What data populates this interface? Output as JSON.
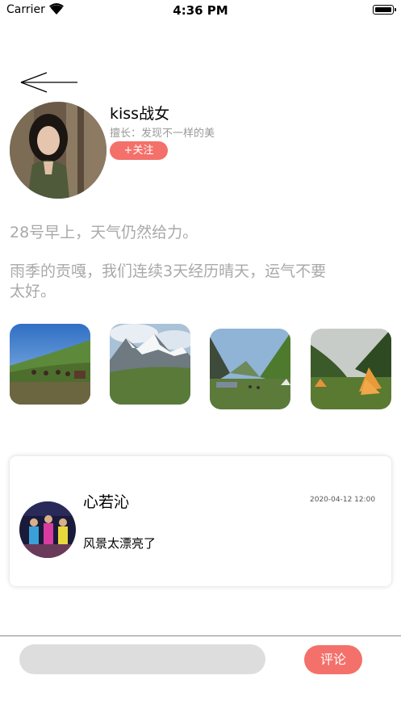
{
  "status_bar": {
    "carrier": "Carrier",
    "time": "4:36 PM"
  },
  "profile": {
    "username": "kiss战女",
    "specialty": "擅长：发现不一样的美",
    "follow_label": "+关注"
  },
  "post": {
    "lines": [
      "28号早上，天气仍然给力。",
      "雨季的贡嘎，我们连续3天经历晴天，运气不要",
      "太好。"
    ],
    "photos": [
      "grassland-horses",
      "snow-mountain",
      "valley-camp",
      "tents-forest"
    ]
  },
  "comment": {
    "author": "心若沁",
    "time": "2020-04-12 12:00",
    "text": "风景太漂亮了"
  },
  "footer": {
    "input_value": "",
    "comment_button": "评论"
  },
  "colors": {
    "accent": "#f4706a",
    "muted_text": "#a9a9a9",
    "input_bg": "#dddddd"
  }
}
